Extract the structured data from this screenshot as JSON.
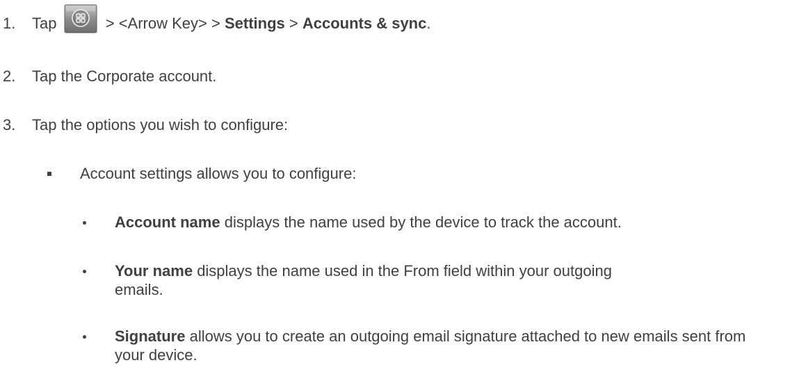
{
  "steps": [
    {
      "number": "1.",
      "prefix": "Tap",
      "between": "> <Arrow Key> >",
      "settings": "Settings",
      "separator": ">",
      "accounts_sync": "Accounts & sync",
      "suffix": ".",
      "icon": "home-key-icon"
    },
    {
      "number": "2.",
      "text": "Tap the Corporate account."
    },
    {
      "number": "3.",
      "text": "Tap the options you wish to configure:"
    }
  ],
  "account_settings": {
    "text": "Account settings allows you to configure:",
    "items": [
      {
        "term": "Account name",
        "description": "displays the name used by the device to track the account."
      },
      {
        "term": "Your name",
        "description": "displays the name used in the From field within your outgoing emails."
      },
      {
        "term": "Signature",
        "description": "allows you to create an outgoing email signature attached to new emails sent from your device."
      }
    ]
  },
  "colors": {
    "text": "#404040",
    "key_background": "#9a9a9a"
  }
}
